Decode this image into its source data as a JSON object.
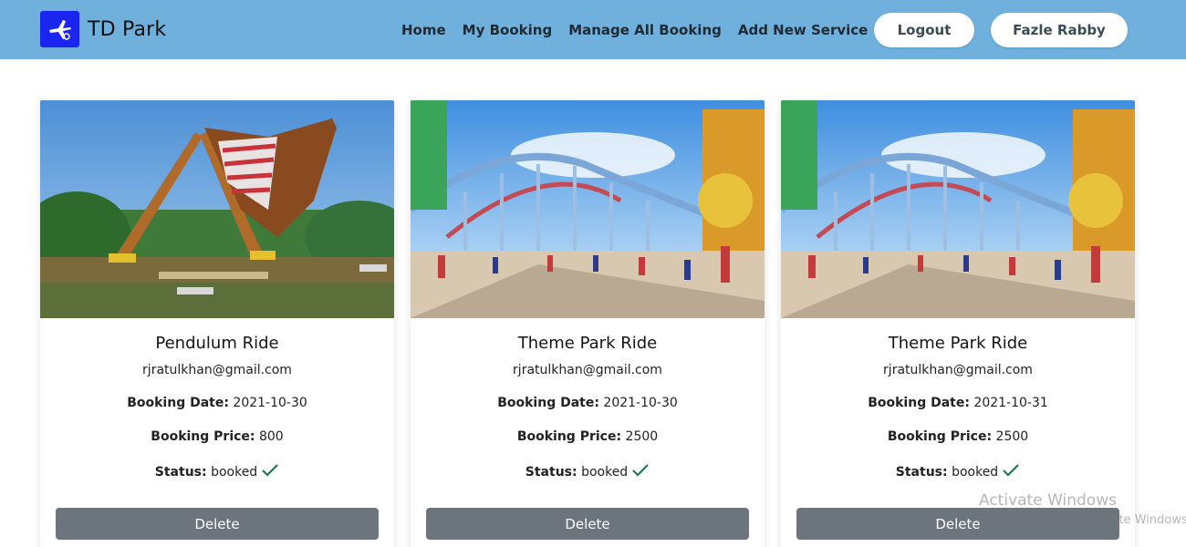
{
  "navbar": {
    "brand_name": "TD Park",
    "links": [
      "Home",
      "My Booking",
      "Manage All Booking",
      "Add New Service"
    ],
    "logout_label": "Logout",
    "user_name": "Fazle Rabby",
    "bg_color": "#6fb0dc"
  },
  "bookings": [
    {
      "title": "Pendulum Ride",
      "email": "rjratulkhan@gmail.com",
      "date_label": "Booking Date:",
      "date": "2021-10-30",
      "price_label": "Booking Price:",
      "price": "800",
      "status_label": "Status:",
      "status": "booked",
      "delete_label": "Delete"
    },
    {
      "title": "Theme Park Ride",
      "email": "rjratulkhan@gmail.com",
      "date_label": "Booking Date:",
      "date": "2021-10-30",
      "price_label": "Booking Price:",
      "price": "2500",
      "status_label": "Status:",
      "status": "booked",
      "delete_label": "Delete"
    },
    {
      "title": "Theme Park Ride",
      "email": "rjratulkhan@gmail.com",
      "date_label": "Booking Date:",
      "date": "2021-10-31",
      "price_label": "Booking Price:",
      "price": "2500",
      "status_label": "Status:",
      "status": "booked",
      "delete_label": "Delete"
    }
  ],
  "watermark": {
    "title": "Activate Windows",
    "subtitle": "Go to Settings to activate Windows."
  },
  "colors": {
    "delete_button": "#6c757d",
    "check": "#1e7a4c"
  }
}
